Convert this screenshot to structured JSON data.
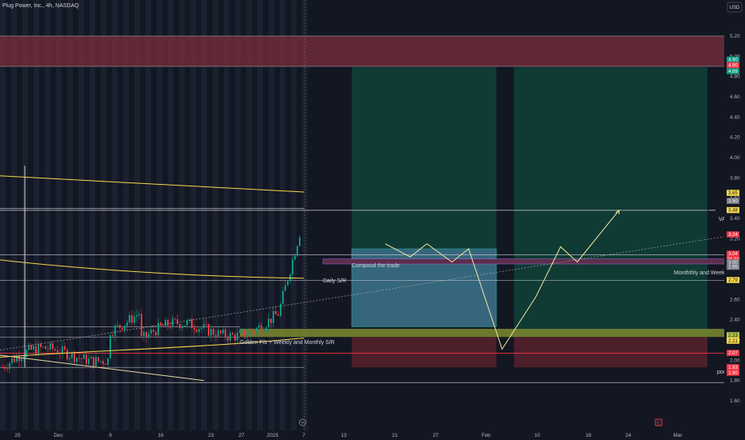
{
  "header": {
    "title": "Plug Power, Inc., 4h, NASDAQ",
    "currency": "USD"
  },
  "chart_data": {
    "type": "candlestick",
    "title": "Plug Power, Inc., 4h, NASDAQ",
    "ylim": [
      1.6,
      5.35
    ],
    "y_ticks": [
      1.6,
      1.8,
      2.0,
      2.2,
      2.4,
      2.6,
      2.8,
      3.0,
      3.2,
      3.4,
      3.6,
      3.8,
      4.0,
      4.2,
      4.4,
      4.6,
      4.8,
      5.0,
      5.2
    ],
    "x_ticks": [
      "25",
      "Dec",
      "9",
      "16",
      "23",
      "27",
      "2025",
      "7",
      "13",
      "21",
      "27",
      "Feb",
      "10",
      "18",
      "24",
      "Mar"
    ],
    "price_badges": [
      {
        "value": "4.90",
        "color": "#089981"
      },
      {
        "value": "4.90",
        "color": "#f23645"
      },
      {
        "value": "4.89",
        "color": "#089981"
      },
      {
        "value": "3.65",
        "color": "#f7d94c"
      },
      {
        "value": "3.50",
        "color": "#787b86"
      },
      {
        "value": "3.48",
        "color": "#f7d94c"
      },
      {
        "value": "3.24",
        "color": "#f23645"
      },
      {
        "value": "3.04",
        "color": "#f23645"
      },
      {
        "value": "21:21",
        "color": "#f23645"
      },
      {
        "value": "3.00",
        "color": "#787b86"
      },
      {
        "value": "2.95",
        "color": "#787b86"
      },
      {
        "value": "2.79",
        "color": "#f7d94c"
      },
      {
        "value": "2.23",
        "color": "#b5c64a"
      },
      {
        "value": "2.21",
        "color": "#f7d94c"
      },
      {
        "value": "2.07",
        "color": "#f23645"
      },
      {
        "value": "1.93",
        "color": "#f23645"
      },
      {
        "value": "1.90",
        "color": "#f23645"
      }
    ],
    "annotations": [
      {
        "text": "Compoud the trade"
      },
      {
        "text": "Daily S/R"
      },
      {
        "text": "Golden Fib + Weekly and Monthly S/R"
      },
      {
        "text": "Monththly and Weekly S/R"
      },
      {
        "text": "VAH"
      },
      {
        "text": "poc"
      }
    ],
    "levels": [
      {
        "price": 5.2,
        "kind": "resistance-zone-top"
      },
      {
        "price": 4.9,
        "kind": "resistance-zone-bottom"
      },
      {
        "price": 3.48,
        "kind": "VAH"
      },
      {
        "price": 3.04,
        "kind": "daily-sr"
      },
      {
        "price": 2.79,
        "kind": "sr"
      },
      {
        "price": 2.07,
        "kind": "poc"
      },
      {
        "price": 1.9,
        "kind": "support"
      }
    ],
    "candles_end": {
      "date": "2025-01-07",
      "close": 3.04
    },
    "projection_path": [
      {
        "date": "2025-01-08",
        "price": 3.15
      },
      {
        "date": "2025-01-11",
        "price": 3.02
      },
      {
        "date": "2025-01-13",
        "price": 3.15
      },
      {
        "date": "2025-01-16",
        "price": 2.97
      },
      {
        "date": "2025-01-18",
        "price": 3.1
      },
      {
        "date": "2025-01-22",
        "price": 2.11
      },
      {
        "date": "2025-01-26",
        "price": 2.62
      },
      {
        "date": "2025-01-29",
        "price": 3.12
      },
      {
        "date": "2025-01-31",
        "price": 2.97
      },
      {
        "date": "2025-02-05",
        "price": 3.48
      }
    ],
    "positions": [
      {
        "type": "long",
        "entry": 3.1,
        "target": 4.89,
        "stop": 1.93
      },
      {
        "type": "long",
        "entry": 2.23,
        "target": 4.89,
        "stop": 1.93
      }
    ]
  }
}
